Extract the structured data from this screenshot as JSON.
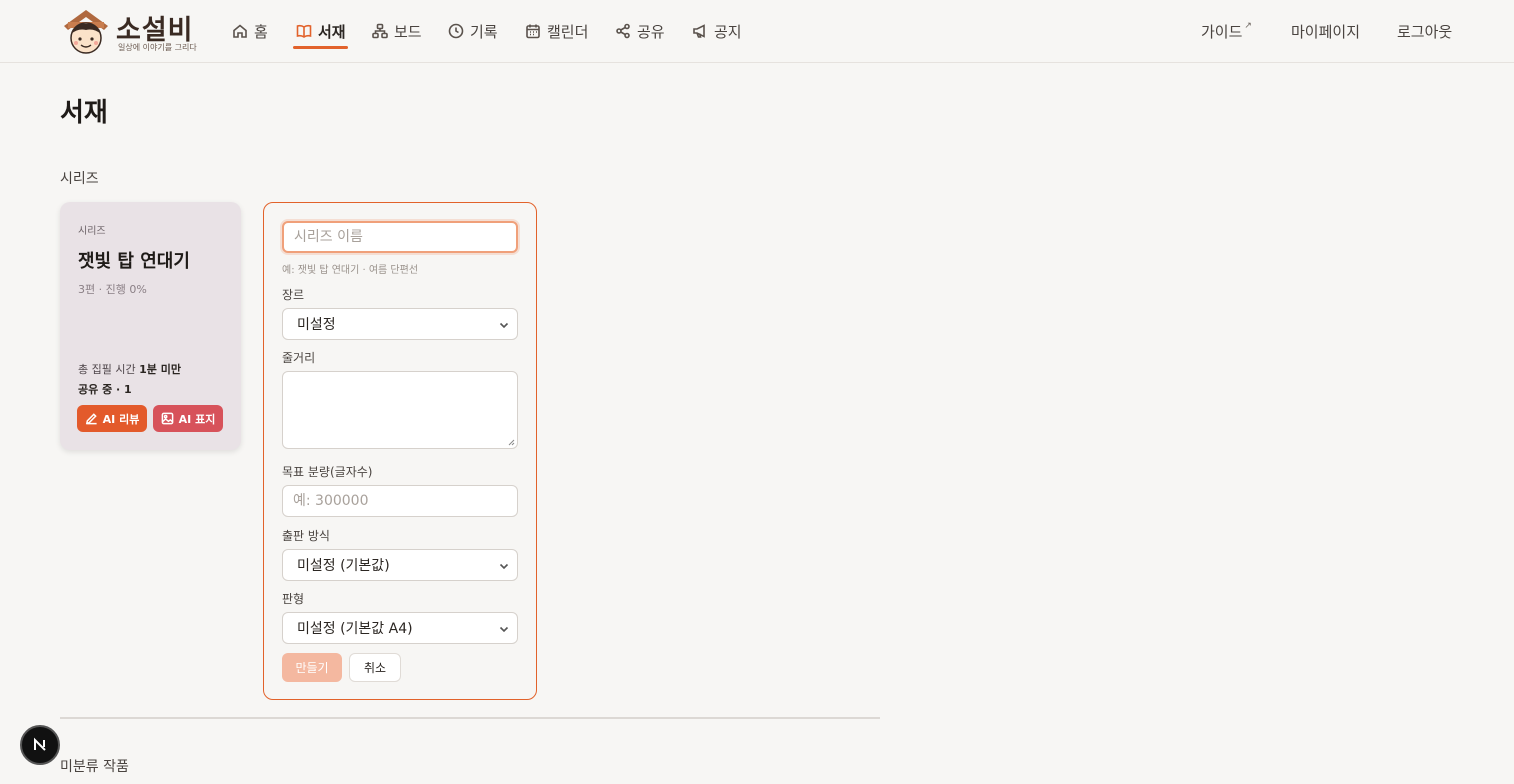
{
  "brand": {
    "title": "소설비",
    "subtitle": "일상에 이야기를 그리다"
  },
  "nav": {
    "items": [
      {
        "label": "홈",
        "icon": "home-icon"
      },
      {
        "label": "서재",
        "icon": "book-icon",
        "active": true
      },
      {
        "label": "보드",
        "icon": "board-icon"
      },
      {
        "label": "기록",
        "icon": "clock-icon"
      },
      {
        "label": "캘린더",
        "icon": "calendar-icon"
      },
      {
        "label": "공유",
        "icon": "share-icon"
      },
      {
        "label": "공지",
        "icon": "megaphone-icon"
      }
    ],
    "right": {
      "guide": "가이드",
      "mypage": "마이페이지",
      "logout": "로그아웃"
    }
  },
  "page": {
    "title": "서재",
    "series_section": "시리즈",
    "unclassified_section": "미분류 작품"
  },
  "series_card": {
    "kicker": "시리즈",
    "title": "잿빛 탑 연대기",
    "meta": "3편 · 진행 0%",
    "time_label": "총 집필 시간",
    "time_value": "1분 미만",
    "share": "공유 중 · 1",
    "review_button": "AI 리뷰",
    "cover_button": "AI 표지"
  },
  "form": {
    "name_placeholder": "시리즈 이름",
    "name_value": "",
    "name_hint": "예: 잿빛 탑 연대기 · 여름 단편선",
    "genre_label": "장르",
    "genre_value": "미설정",
    "synopsis_label": "줄거리",
    "synopsis_value": "",
    "target_label": "목표 분량(글자수)",
    "target_placeholder": "예: 300000",
    "publish_label": "출판 방식",
    "publish_value": "미설정 (기본값)",
    "format_label": "판형",
    "format_value": "미설정 (기본값 A4)",
    "create_button": "만들기",
    "cancel_button": "취소"
  },
  "colors": {
    "accent": "#e2622b",
    "card_bg": "#e9e2e6",
    "review_button": "#e35a2b",
    "cover_button": "#d7525a",
    "create_disabled": "#f4b8a0"
  }
}
